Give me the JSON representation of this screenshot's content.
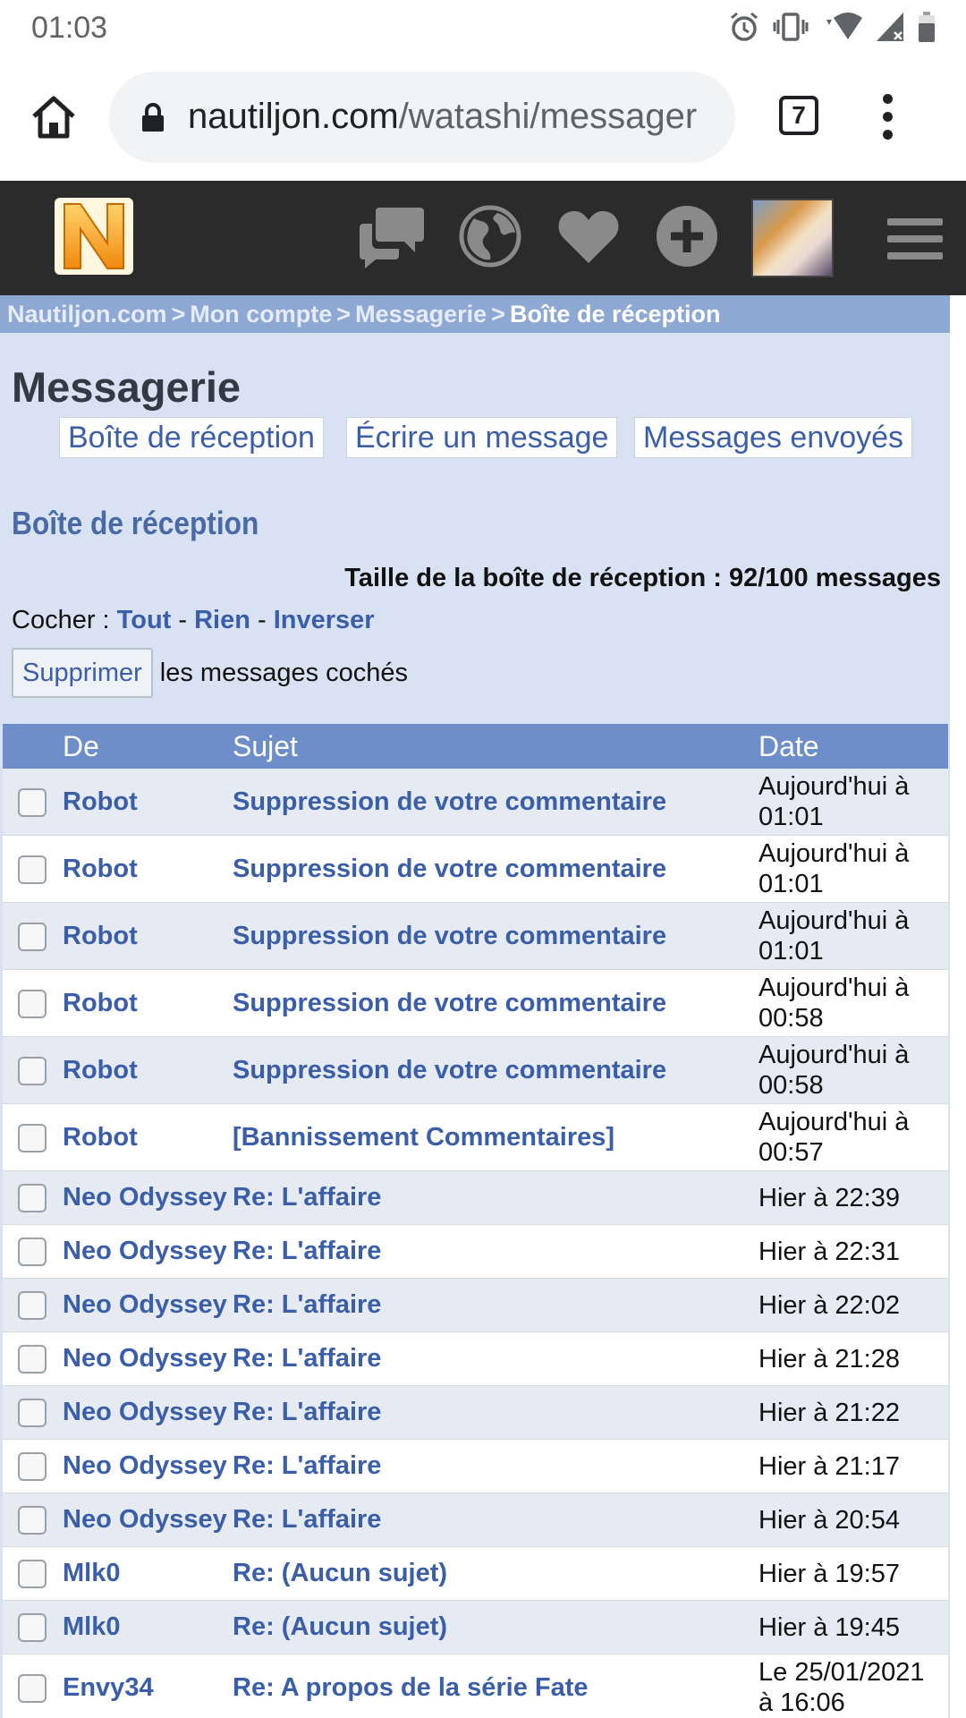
{
  "status_bar": {
    "time": "01:03",
    "icons": [
      "alarm-icon",
      "vibrate-icon",
      "wifi-icon",
      "signal-icon",
      "battery-icon"
    ]
  },
  "browser": {
    "url_host": "nautiljon.com",
    "url_path": "/watashi/messager",
    "tab_count": "7"
  },
  "site_header": {
    "logo_letter": "N",
    "icons": [
      "forum-icon",
      "globe-icon",
      "heart-icon",
      "plus-icon",
      "avatar",
      "menu-icon"
    ]
  },
  "breadcrumb": {
    "items": [
      "Nautiljon.com",
      "Mon compte",
      "Messagerie"
    ],
    "separator": ">",
    "current": "Boîte de réception"
  },
  "page": {
    "title": "Messagerie",
    "nav": [
      "Boîte de réception",
      "Écrire un message",
      "Messages envoyés"
    ],
    "section_title": "Boîte de réception",
    "quota": "Taille de la boîte de réception : 92/100 messages",
    "check_label": "Cocher : ",
    "check_all": "Tout",
    "check_none": "Rien",
    "check_invert": "Inverser",
    "check_sep": " - ",
    "delete_button": "Supprimer",
    "delete_suffix": "les messages cochés"
  },
  "table": {
    "headers": {
      "from": "De",
      "subject": "Sujet",
      "date": "Date"
    },
    "rows": [
      {
        "from": "Robot",
        "subject": "Suppression de votre commentaire",
        "date": "Aujourd'hui à 01:01"
      },
      {
        "from": "Robot",
        "subject": "Suppression de votre commentaire",
        "date": "Aujourd'hui à 01:01"
      },
      {
        "from": "Robot",
        "subject": "Suppression de votre commentaire",
        "date": "Aujourd'hui à 01:01"
      },
      {
        "from": "Robot",
        "subject": "Suppression de votre commentaire",
        "date": "Aujourd'hui à 00:58"
      },
      {
        "from": "Robot",
        "subject": "Suppression de votre commentaire",
        "date": "Aujourd'hui à 00:58"
      },
      {
        "from": "Robot",
        "subject": "[Bannissement Commentaires]",
        "date": "Aujourd'hui à 00:57"
      },
      {
        "from": "Neo Odyssey",
        "subject": "Re: L'affaire",
        "date": "Hier à 22:39"
      },
      {
        "from": "Neo Odyssey",
        "subject": "Re: L'affaire",
        "date": "Hier à 22:31"
      },
      {
        "from": "Neo Odyssey",
        "subject": "Re: L'affaire",
        "date": "Hier à 22:02"
      },
      {
        "from": "Neo Odyssey",
        "subject": "Re: L'affaire",
        "date": "Hier à 21:28"
      },
      {
        "from": "Neo Odyssey",
        "subject": "Re: L'affaire",
        "date": "Hier à 21:22"
      },
      {
        "from": "Neo Odyssey",
        "subject": "Re: L'affaire",
        "date": "Hier à 21:17"
      },
      {
        "from": "Neo Odyssey",
        "subject": "Re: L'affaire",
        "date": "Hier à 20:54"
      },
      {
        "from": "Mlk0",
        "subject": "Re: (Aucun sujet)",
        "date": "Hier à 19:57"
      },
      {
        "from": "Mlk0",
        "subject": "Re: (Aucun sujet)",
        "date": "Hier à 19:45"
      },
      {
        "from": "Envy34",
        "subject": "Re: A propos de la série Fate",
        "date": "Le 25/01/2021 à 16:06"
      }
    ]
  },
  "colors": {
    "link": "#3a5ea8",
    "header_bg": "#2b2b2b",
    "breadcrumb_bg": "#8ea8d4",
    "content_bg": "#d9e2f3",
    "table_head_bg": "#6d8ec8",
    "logo": "#f5a623"
  }
}
